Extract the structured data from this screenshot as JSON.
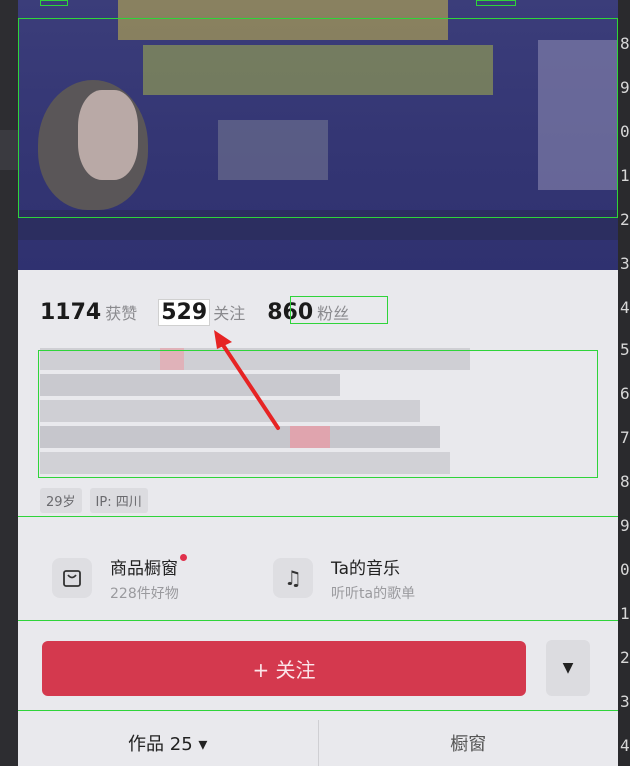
{
  "ruler": {
    "digits": [
      "8",
      "9",
      "0",
      "1",
      "2",
      "3",
      "4",
      "5",
      "6",
      "7",
      "8",
      "9",
      "0",
      "1",
      "2",
      "3",
      "4"
    ]
  },
  "stats": [
    {
      "value": "1174",
      "label": "获赞"
    },
    {
      "value": "529",
      "label": "关注"
    },
    {
      "value": "860",
      "label": "粉丝"
    }
  ],
  "tags": [
    "29岁",
    "IP: 四川"
  ],
  "features": [
    {
      "icon": "bag-icon",
      "title": "商品橱窗",
      "subtitle": "228件好物"
    },
    {
      "icon": "music-icon",
      "title": "Ta的音乐",
      "subtitle": "听听ta的歌单"
    }
  ],
  "actions": {
    "follow_label": "+ 关注",
    "more_glyph": "▼"
  },
  "tabs": [
    {
      "label": "作品 25 ▾"
    },
    {
      "label": "橱窗"
    }
  ],
  "colors": {
    "accent": "#d4394e",
    "highlight_box": "#2fd43a",
    "arrow": "#e62424"
  }
}
